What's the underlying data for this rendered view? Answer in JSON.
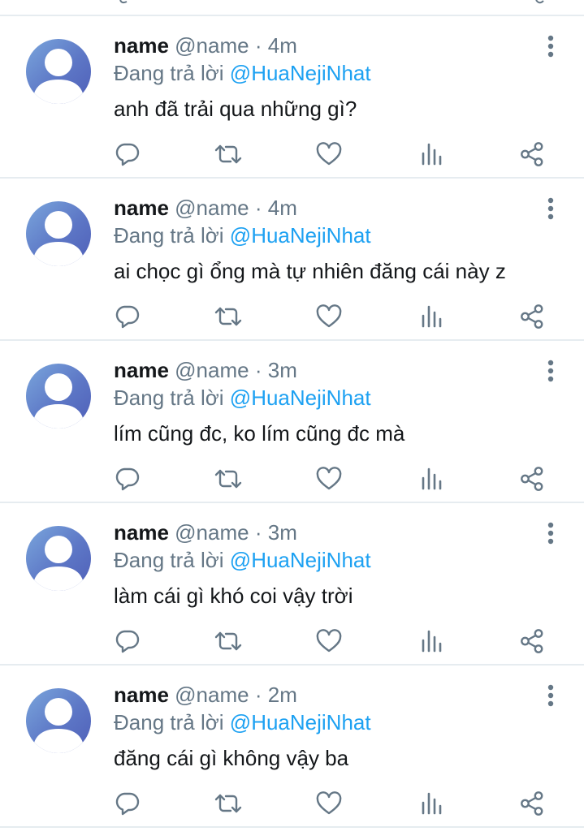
{
  "colors": {
    "text_primary": "#14171a",
    "text_secondary": "#657786",
    "mention": "#1da1f2",
    "divider": "#e6ecf0",
    "icon": "#657786"
  },
  "icons": {
    "reply": "speech-bubble",
    "retweet": "retweet-arrows",
    "like": "heart-outline",
    "stats": "bar-chart",
    "share": "share-nodes",
    "more": "vertical-ellipsis"
  },
  "tweets": [
    {
      "display_name": "name",
      "handle": "@name",
      "separator": "·",
      "time": "4m",
      "reply_prefix": "Đang trả lời",
      "reply_to": "@HuaNejiNhat",
      "text": "anh đã trải qua những gì?"
    },
    {
      "display_name": "name",
      "handle": "@name",
      "separator": "·",
      "time": "4m",
      "reply_prefix": "Đang trả lời",
      "reply_to": "@HuaNejiNhat",
      "text": "ai chọc gì ổng mà tự nhiên đăng cái này z"
    },
    {
      "display_name": "name",
      "handle": "@name",
      "separator": "·",
      "time": "3m",
      "reply_prefix": "Đang trả lời",
      "reply_to": "@HuaNejiNhat",
      "text": "lím cũng đc, ko lím cũng đc mà"
    },
    {
      "display_name": "name",
      "handle": "@name",
      "separator": "·",
      "time": "3m",
      "reply_prefix": "Đang trả lời",
      "reply_to": "@HuaNejiNhat",
      "text": "làm cái gì khó coi vậy trời"
    },
    {
      "display_name": "name",
      "handle": "@name",
      "separator": "·",
      "time": "2m",
      "reply_prefix": "Đang trả lời",
      "reply_to": "@HuaNejiNhat",
      "text": "đăng cái gì không vậy ba"
    }
  ]
}
